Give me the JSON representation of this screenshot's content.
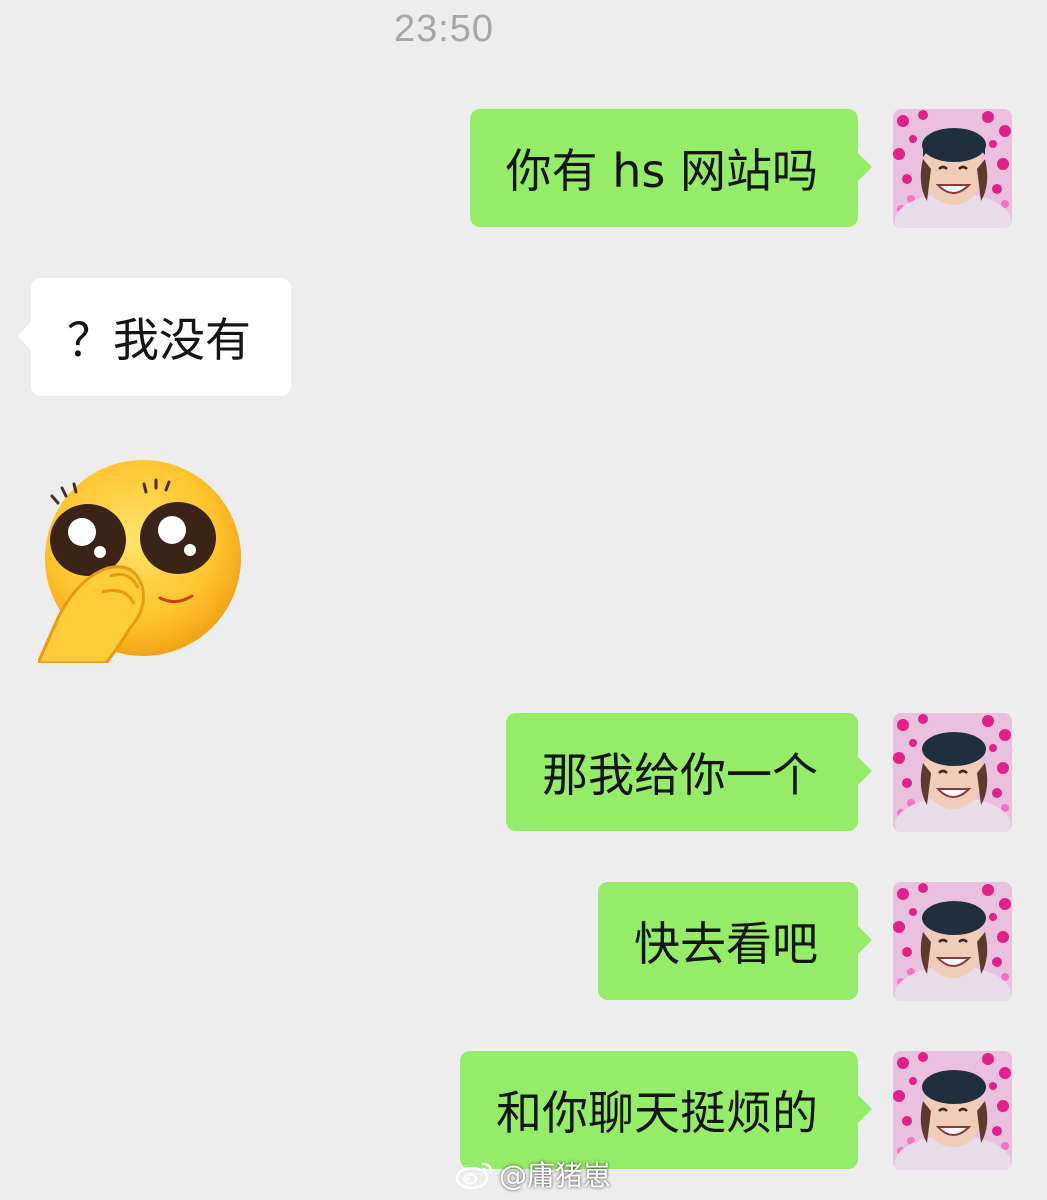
{
  "chat": {
    "timestamp": "23:50",
    "messages": [
      {
        "side": "out",
        "text": "你有 hs 网站吗"
      },
      {
        "side": "in",
        "text": "？我没有"
      },
      {
        "side": "in",
        "sticker": "shy-smiling-face-sticker"
      },
      {
        "side": "out",
        "text": "那我给你一个"
      },
      {
        "side": "out",
        "text": "快去看吧"
      },
      {
        "side": "out",
        "text": "和你聊天挺烦的"
      }
    ]
  },
  "watermark": {
    "text": "@庸猪崽",
    "icon": "weibo-logo-icon"
  },
  "colors": {
    "background": "#ededed",
    "outgoing_bubble": "#95ec69",
    "incoming_bubble": "#ffffff",
    "timestamp": "#a6a6a6"
  }
}
